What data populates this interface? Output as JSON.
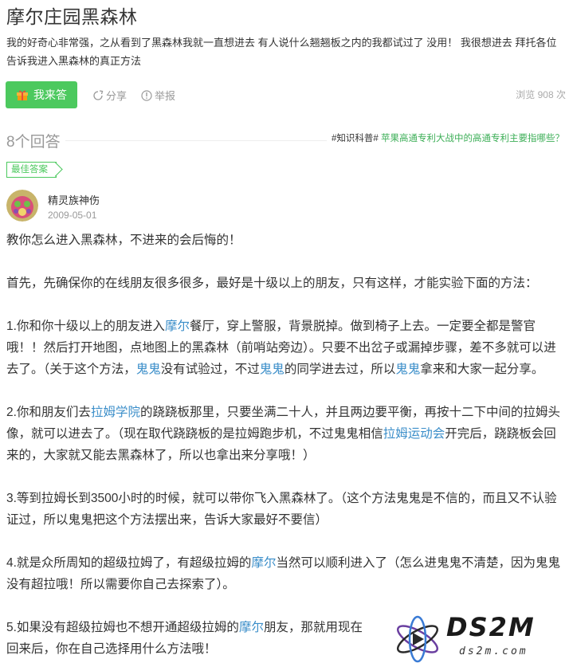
{
  "question": {
    "title": "摩尔庄园黑森林",
    "description": "我的好奇心非常强，之从看到了黑森林我就一直想进去 有人说什么翘翘板之内的我都试过了 没用！ 我很想进去 拜托各位告诉我进入黑森林的真正方法"
  },
  "actions": {
    "answer_label": "我来答",
    "share_label": "分享",
    "report_label": "举报",
    "views_text": "浏览 908 次"
  },
  "answers_header": {
    "count_text": "8个回答",
    "promo_tag": "#知识科普#",
    "promo_link": "苹果高通专利大战中的高通专利主要指哪些？"
  },
  "best_answer": {
    "badge": "最佳答案",
    "user": "精灵族神伤",
    "date": "2009-05-01",
    "p1": "教你怎么进入黑森林，不进来的会后悔的！",
    "p2": "首先，先确保你的在线朋友很多很多，最好是十级以上的朋友，只有这样，才能实验下面的方法：",
    "p3": {
      "a": "1.你和你十级以上的朋友进入",
      "l1": "摩尔",
      "b": "餐厅，穿上警服，背景脱掉。做到椅子上去。一定要全都是警官哦！！然后打开地图，点地图上的黑森林（前哨站旁边）。只要不出岔子或漏掉步骤，差不多就可以进去了。（关于这个方法，",
      "l2": "鬼鬼",
      "c": "没有试验过，不过",
      "l3": "鬼鬼",
      "d": "的同学进去过，所以",
      "l4": "鬼鬼",
      "e": "拿来和大家一起分享。"
    },
    "p4": {
      "a": "2.你和朋友们去",
      "l1": "拉姆学院",
      "b": "的跷跷板那里，只要坐满二十人，并且两边要平衡，再按十二下中间的拉姆头像，就可以进去了。（现在取代跷跷板的是拉姆跑步机，不过鬼鬼相信",
      "l2": "拉姆运动会",
      "c": "开完后，跷跷板会回来的，大家就又能去黑森林了，所以也拿出来分享哦！）"
    },
    "p5": "3.等到拉姆长到3500小时的时候，就可以带你飞入黑森林了。（这个方法鬼鬼是不信的，而且又不认验证过，所以鬼鬼把这个方法摆出来，告诉大家最好不要信）",
    "p6": {
      "a": "4.就是众所周知的超级拉姆了，有超级拉姆的",
      "l1": "摩尔",
      "b": "当然可以顺利进入了（怎么进鬼鬼不清楚，因为鬼鬼没有超拉哦！所以需要你自己去探索了）。"
    },
    "p7": {
      "a": "5.如果没有超级拉姆也不想开通超级拉姆的",
      "l1": "摩尔",
      "b": "朋友，那就用现在",
      "c": "回来后，你在自己选择用什么方法哦！"
    }
  },
  "watermark": {
    "main": "DS2M",
    "sub": "ds2m.com"
  },
  "colors": {
    "accent_green": "#4cc95e",
    "link_blue": "#3b8ec9",
    "muted": "#999999"
  }
}
